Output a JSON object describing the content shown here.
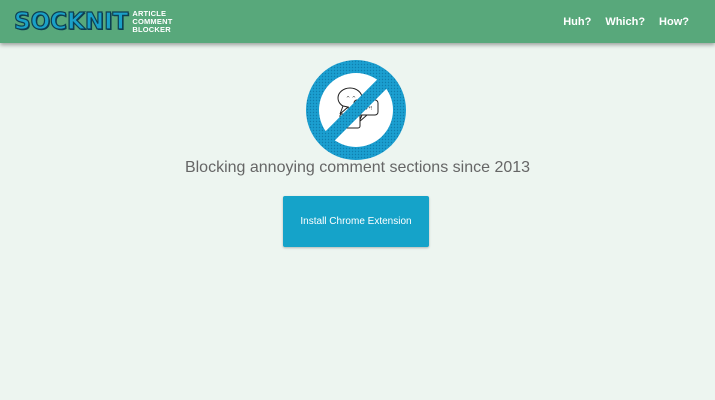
{
  "brand": {
    "logo_text": "SOCKNIT",
    "tagline_line1": "ARTICLE",
    "tagline_line2": "COMMENT",
    "tagline_line3": "BLOCKER"
  },
  "nav": {
    "items": [
      {
        "label": "Huh?"
      },
      {
        "label": "Which?"
      },
      {
        "label": "How?"
      }
    ]
  },
  "hero": {
    "icon": "no-comments-icon",
    "bubble_left_text": "^ ^",
    "bubble_right_text": "@#*!",
    "headline": "Blocking annoying comment sections since 2013",
    "install_button_label": "Install Chrome Extension"
  },
  "colors": {
    "header_bg": "#58a87b",
    "page_bg": "#edf5f0",
    "accent": "#15a3c9",
    "text_muted": "#666666"
  }
}
